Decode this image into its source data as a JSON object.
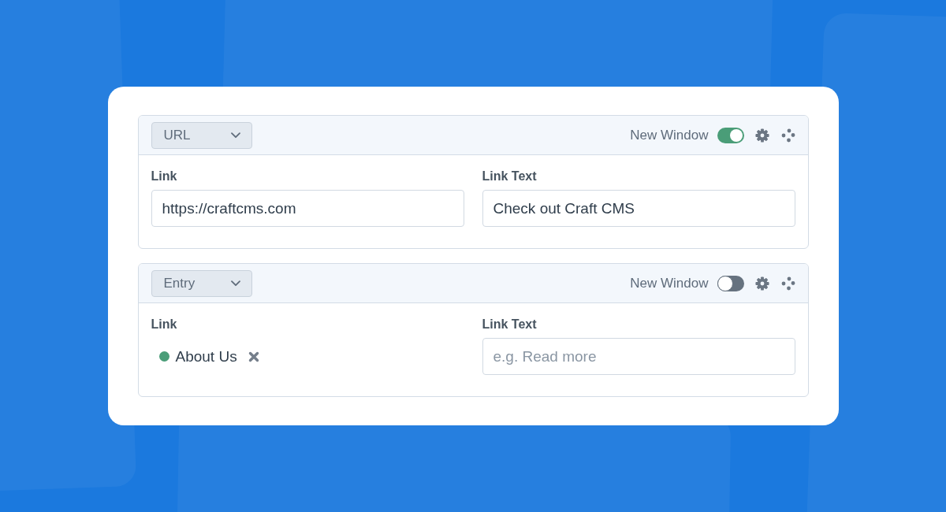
{
  "links": [
    {
      "type": {
        "label": "URL"
      },
      "new_window": {
        "label": "New Window",
        "on": true
      },
      "link": {
        "label": "Link",
        "kind": "input",
        "value": "https://craftcms.com"
      },
      "link_text": {
        "label": "Link Text",
        "value": "Check out Craft CMS"
      }
    },
    {
      "type": {
        "label": "Entry"
      },
      "new_window": {
        "label": "New Window",
        "on": false
      },
      "link": {
        "label": "Link",
        "kind": "element",
        "element": {
          "title": "About Us",
          "enabled": true
        }
      },
      "link_text": {
        "label": "Link Text",
        "placeholder": "e.g. Read more"
      }
    }
  ]
}
